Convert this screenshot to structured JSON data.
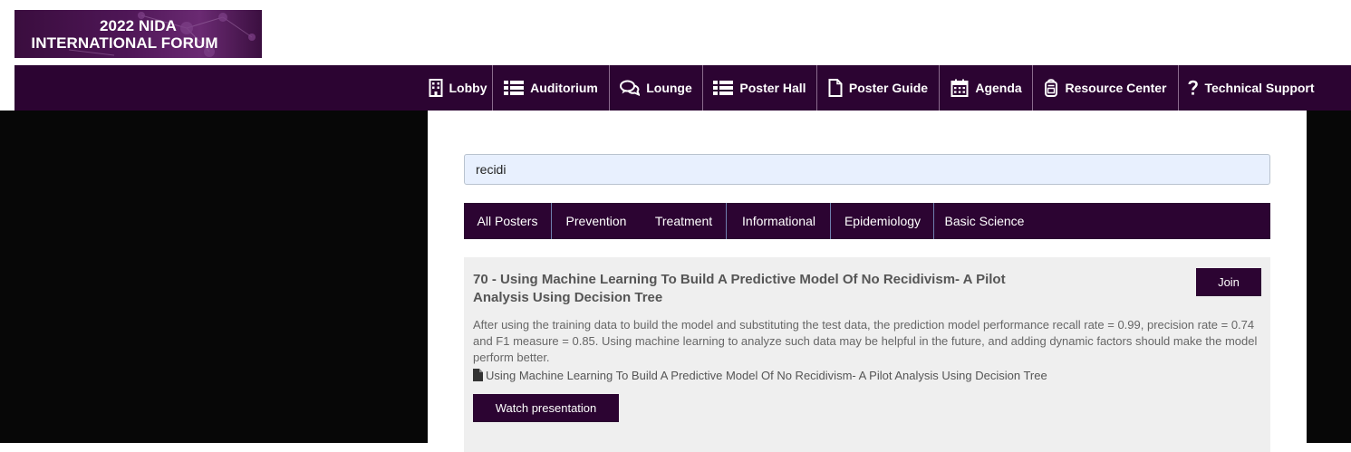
{
  "branding": {
    "logo_line1": "2022 NIDA",
    "logo_line2": "INTERNATIONAL FORUM"
  },
  "nav": {
    "items": [
      {
        "label": "Lobby",
        "icon": "building-icon"
      },
      {
        "label": "Auditorium",
        "icon": "list-icon"
      },
      {
        "label": "Lounge",
        "icon": "comments-icon"
      },
      {
        "label": "Poster Hall",
        "icon": "list-icon"
      },
      {
        "label": "Poster Guide",
        "icon": "file-icon"
      },
      {
        "label": "Agenda",
        "icon": "calendar-icon"
      },
      {
        "label": "Resource Center",
        "icon": "backpack-icon"
      },
      {
        "label": "Technical Support",
        "icon": "question-icon"
      }
    ]
  },
  "search": {
    "value": "recidi"
  },
  "filters": {
    "tabs": [
      "All Posters",
      "Prevention",
      "Treatment",
      "Informational",
      "Epidemiology",
      "Basic Science"
    ]
  },
  "poster": {
    "title": "70 - Using Machine Learning To Build A Predictive Model Of No Recidivism- A Pilot Analysis Using Decision Tree",
    "join_label": "Join",
    "abstract": "After using the training data to build the model and substituting the test data, the prediction model performance recall rate = 0.99, precision rate = 0.74 and F1 measure = 0.85. Using machine learning to analyze such data may be helpful in the future, and adding dynamic factors should make the model perform better.",
    "file_label": "Using Machine Learning To Build A Predictive Model Of No Recidivism- A Pilot Analysis Using Decision Tree",
    "watch_label": "Watch presentation"
  },
  "colors": {
    "brand": "#2c0432",
    "card_bg": "#efefef",
    "search_bg": "#e8f0fe"
  }
}
